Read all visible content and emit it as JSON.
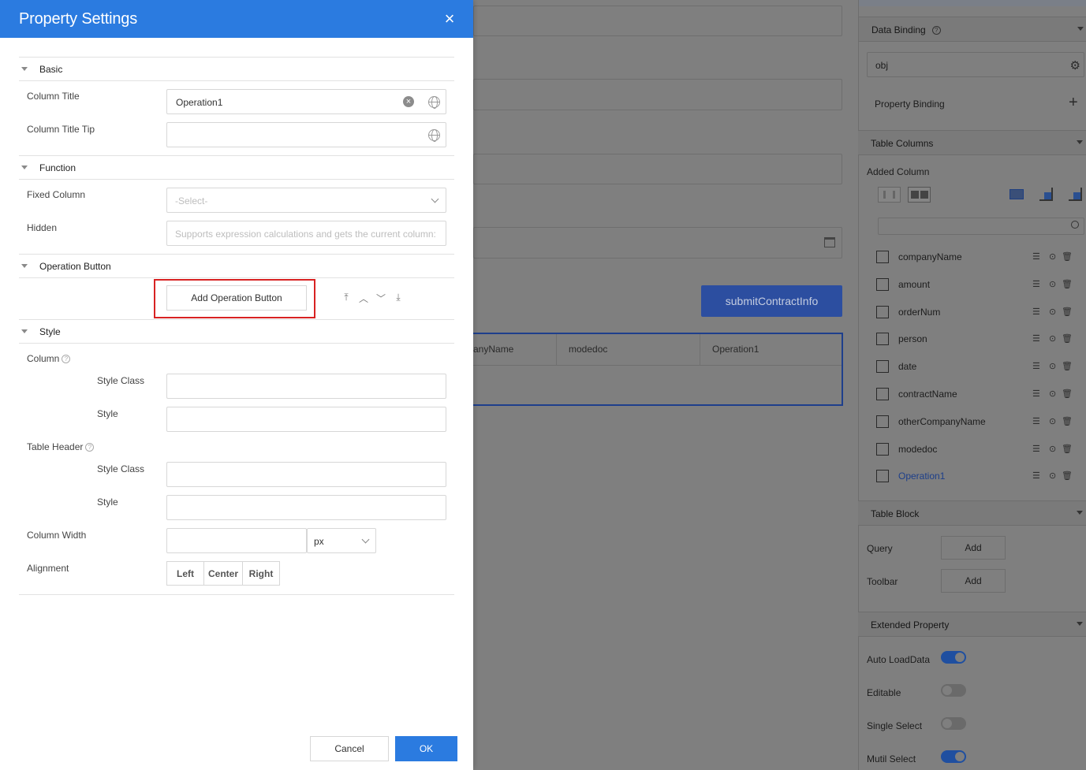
{
  "dialog": {
    "title": "Property Settings",
    "close_glyph": "×",
    "sections": {
      "basic": "Basic",
      "function": "Function",
      "operation_button": "Operation Button",
      "style": "Style"
    },
    "fields": {
      "column_title_label": "Column Title",
      "column_title_value": "Operation1",
      "column_title_tip_label": "Column Title Tip",
      "column_title_tip_value": "",
      "fixed_column_label": "Fixed Column",
      "fixed_column_placeholder": "-Select-",
      "hidden_label": "Hidden",
      "hidden_placeholder": "Supports expression calculations and gets the current column:",
      "add_operation_button": "Add Operation Button",
      "column_label": "Column",
      "style_class_label": "Style Class",
      "style_label": "Style",
      "table_header_label": "Table Header",
      "column_width_label": "Column Width",
      "column_width_value": "",
      "column_width_unit": "px",
      "alignment_label": "Alignment",
      "align_left": "Left",
      "align_center": "Center",
      "align_right": "Right"
    },
    "footer": {
      "cancel": "Cancel",
      "ok": "OK"
    }
  },
  "canvas": {
    "submit_button": "submitContractInfo",
    "table_headers": [
      "anyName",
      "modedoc",
      "Operation1"
    ]
  },
  "right_panel": {
    "data_binding_title": "Data Binding",
    "data_binding_value": "obj",
    "property_binding_label": "Property Binding",
    "table_columns_title": "Table Columns",
    "added_column_label": "Added Column",
    "columns": [
      {
        "name": "companyName",
        "active": false
      },
      {
        "name": "amount",
        "active": false
      },
      {
        "name": "orderNum",
        "active": false
      },
      {
        "name": "person",
        "active": false
      },
      {
        "name": "date",
        "active": false
      },
      {
        "name": "contractName",
        "active": false
      },
      {
        "name": "otherCompanyName",
        "active": false
      },
      {
        "name": "modedoc",
        "active": false
      },
      {
        "name": "Operation1",
        "active": true
      }
    ],
    "table_block_title": "Table Block",
    "query_label": "Query",
    "query_add": "Add",
    "toolbar_label": "Toolbar",
    "toolbar_add": "Add",
    "extended_property_title": "Extended Property",
    "toggles": [
      {
        "label": "Auto LoadData",
        "on": true
      },
      {
        "label": "Editable",
        "on": false
      },
      {
        "label": "Single Select",
        "on": false
      },
      {
        "label": "Mutil Select",
        "on": true
      }
    ]
  },
  "colors": {
    "dialog_header": "#2b7be0",
    "ok_button": "#2b7be0",
    "highlight_border": "#d82222",
    "overlay": "#7f7f7f"
  }
}
